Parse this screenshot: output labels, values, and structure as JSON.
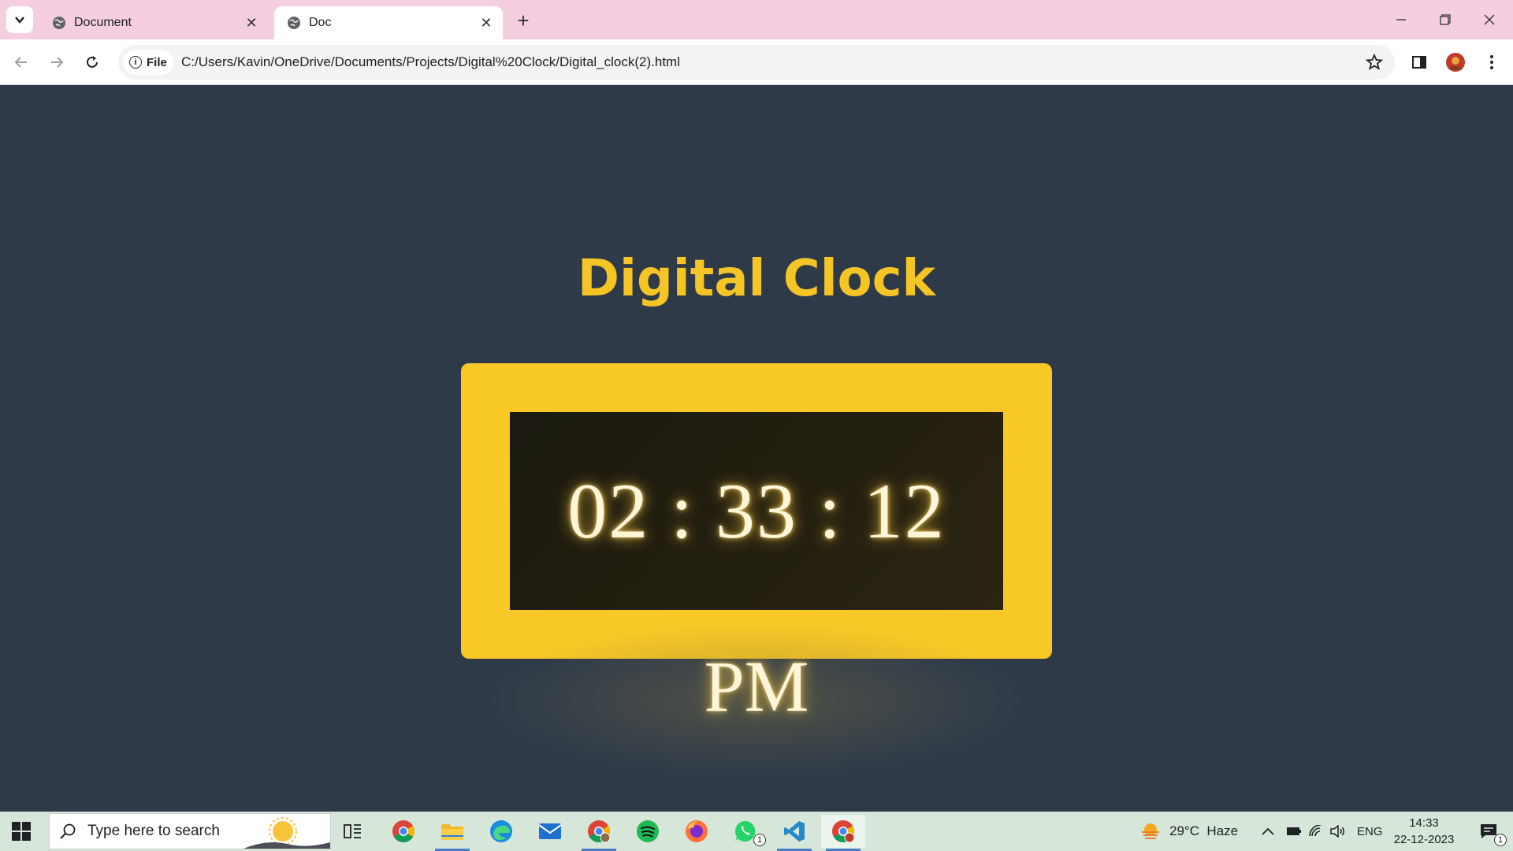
{
  "browser": {
    "tabs": [
      {
        "title": "Document",
        "active": false
      },
      {
        "title": "Doc",
        "active": true
      }
    ],
    "address_scheme_label": "File",
    "address_url": "C:/Users/Kavin/OneDrive/Documents/Projects/Digital%20Clock/Digital_clock(2).html"
  },
  "page": {
    "title": "Digital Clock",
    "time": "02 : 33 : 12",
    "meridiem": "PM",
    "colors": {
      "background": "#2e3a48",
      "accent": "#f8c826",
      "screen": "#1f1c10",
      "digits": "#fff5d8"
    }
  },
  "taskbar": {
    "search_placeholder": "Type here to search",
    "apps": [
      "chrome-icon",
      "task-view-icon",
      "file-explorer-icon",
      "edge-icon",
      "mail-icon",
      "chrome-profile-icon",
      "spotify-icon",
      "firefox-icon",
      "whatsapp-icon",
      "vscode-icon",
      "chrome-active-icon"
    ],
    "whatsapp_badge": "1",
    "weather": "29°C  Haze",
    "language": "ENG",
    "time": "14:33",
    "date": "22-12-2023",
    "notification_badge": "1"
  }
}
